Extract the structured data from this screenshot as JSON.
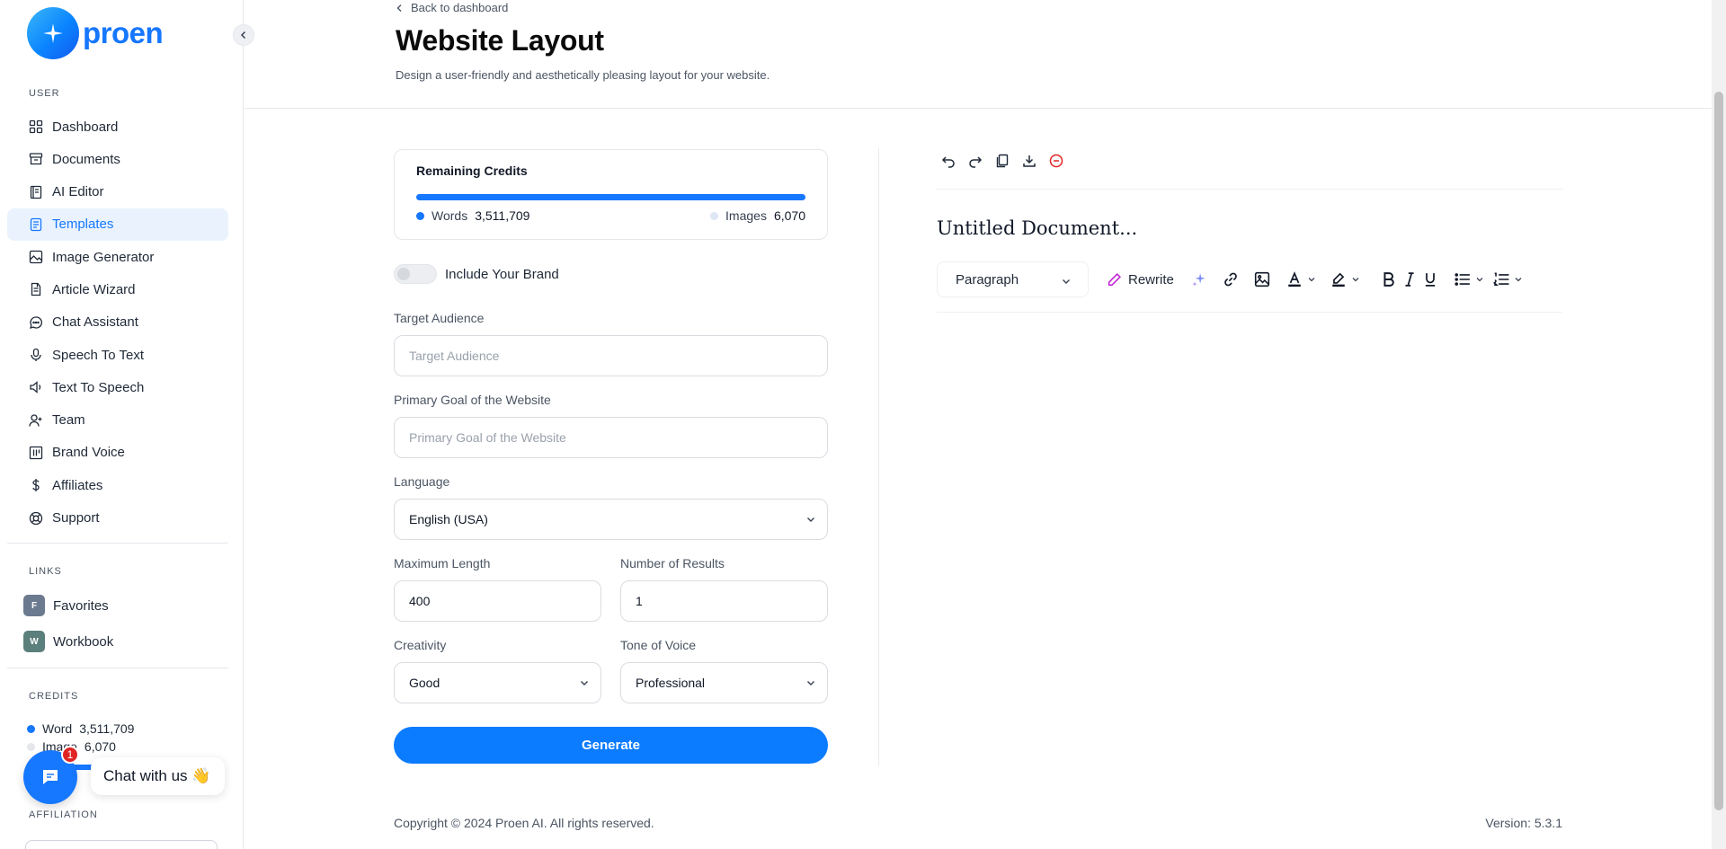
{
  "brand": {
    "name": "proen"
  },
  "sidebar": {
    "user_section": "USER",
    "items": [
      {
        "label": "Dashboard",
        "icon": "grid-icon"
      },
      {
        "label": "Documents",
        "icon": "archive-icon"
      },
      {
        "label": "AI Editor",
        "icon": "book-icon"
      },
      {
        "label": "Templates",
        "icon": "document-icon",
        "active": true
      },
      {
        "label": "Image Generator",
        "icon": "image-icon"
      },
      {
        "label": "Article Wizard",
        "icon": "article-icon"
      },
      {
        "label": "Chat Assistant",
        "icon": "chat-icon"
      },
      {
        "label": "Speech To Text",
        "icon": "microphone-icon"
      },
      {
        "label": "Text To Speech",
        "icon": "speaker-icon"
      },
      {
        "label": "Team",
        "icon": "user-plus-icon"
      },
      {
        "label": "Brand Voice",
        "icon": "columns-icon"
      },
      {
        "label": "Affiliates",
        "icon": "dollar-icon"
      },
      {
        "label": "Support",
        "icon": "lifebuoy-icon"
      }
    ],
    "links_section": "LINKS",
    "links": [
      {
        "initial": "F",
        "label": "Favorites",
        "color": "#6b7a8f"
      },
      {
        "initial": "W",
        "label": "Workbook",
        "color": "#5b7f7c"
      }
    ],
    "credits_section": "CREDITS",
    "credits": {
      "word_label": "Word",
      "word_value": "3,511,709",
      "image_label": "Image",
      "image_value": "6,070"
    },
    "affiliation_section": "AFFILIATION"
  },
  "chat": {
    "label": "Chat with us 👋",
    "badge": "1"
  },
  "header": {
    "back_label": "Back to dashboard",
    "title": "Website Layout",
    "subtitle": "Design a user-friendly and aesthetically pleasing layout for your website."
  },
  "form": {
    "credits": {
      "title": "Remaining Credits",
      "words_label": "Words",
      "words_value": "3,511,709",
      "images_label": "Images",
      "images_value": "6,070"
    },
    "brand_toggle": {
      "label": "Include Your Brand",
      "on": false
    },
    "target_audience": {
      "label": "Target Audience",
      "placeholder": "Target Audience",
      "value": ""
    },
    "primary_goal": {
      "label": "Primary Goal of the Website",
      "placeholder": "Primary Goal of the Website",
      "value": ""
    },
    "language": {
      "label": "Language",
      "value": "English (USA)"
    },
    "max_length": {
      "label": "Maximum Length",
      "value": "400"
    },
    "num_results": {
      "label": "Number of Results",
      "value": "1"
    },
    "creativity": {
      "label": "Creativity",
      "value": "Good"
    },
    "tone": {
      "label": "Tone of Voice",
      "value": "Professional"
    },
    "generate_label": "Generate"
  },
  "editor": {
    "doc_title": "Untitled Document...",
    "paragraph_select": "Paragraph",
    "rewrite_label": "Rewrite"
  },
  "footer": {
    "copyright": "Copyright © 2024 Proen AI. All rights reserved.",
    "version": "Version: 5.3.1"
  },
  "colors": {
    "accent": "#1677ff",
    "active_bg": "#eaf3fd",
    "danger": "#e02424"
  }
}
